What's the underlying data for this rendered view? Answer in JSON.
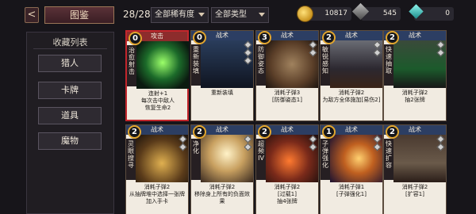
{
  "header": {
    "back_glyph": "<",
    "title": "图鉴",
    "count": "28/28",
    "rarity_filter": "全部稀有度",
    "type_filter": "全部类型"
  },
  "resources": {
    "gold": "10817",
    "ore": "545",
    "gem": "0"
  },
  "sidebar": {
    "title": "收藏列表",
    "items": [
      {
        "label": "猎人"
      },
      {
        "label": "卡牌"
      },
      {
        "label": "道具"
      },
      {
        "label": "魔物"
      }
    ]
  },
  "cards": [
    {
      "cost": "0",
      "type": "攻击",
      "name": "治愈射击",
      "desc": "连射+1\n每次击中敌人\n恢复生命2",
      "selected": true,
      "pips": 0,
      "art_icon": "green-heart-icon"
    },
    {
      "cost": "0",
      "type": "战术",
      "name": "重新装填",
      "desc": "重新装填",
      "selected": false,
      "pips": 3,
      "art_icon": "revolver-reload-icon"
    },
    {
      "cost": "3",
      "type": "战术",
      "name": "防御姿态",
      "desc": "消耗子弹3\n[防御姿态1]",
      "selected": false,
      "pips": 2,
      "art_icon": "shield-icon"
    },
    {
      "cost": "2",
      "type": "战术",
      "name": "敏锐感知",
      "desc": "消耗子弹2\n为敌方全体施加[易伤2]",
      "selected": false,
      "pips": 2,
      "art_icon": "awareness-icon"
    },
    {
      "cost": "2",
      "type": "战术",
      "name": "快速抽取",
      "desc": "消耗子弹2\n抽2张牌",
      "selected": false,
      "pips": 2,
      "art_icon": "cards-icon"
    },
    {
      "cost": "2",
      "type": "战术",
      "name": "灵眼搜寻",
      "desc": "消耗子弹2\n从抽牌堆中选择一张牌\n加入手卡",
      "selected": false,
      "pips": 2,
      "art_icon": "treasure-icon"
    },
    {
      "cost": "2",
      "type": "战术",
      "name": "净化",
      "desc": "消耗子弹2\n移除身上所有的负面效果",
      "selected": false,
      "pips": 2,
      "art_icon": "purify-icon"
    },
    {
      "cost": "2",
      "type": "战术",
      "name": "超频IV",
      "desc": "消耗子弹2\n[过载1]\n抽4张牌",
      "selected": false,
      "pips": 2,
      "art_icon": "overclock-icon"
    },
    {
      "cost": "1",
      "type": "战术",
      "name": "子弹强化",
      "desc": "消耗子弹1\n[子弹强化1]",
      "selected": false,
      "pips": 2,
      "art_icon": "bullet-icon"
    },
    {
      "cost": "2",
      "type": "战术",
      "name": "快速扩容",
      "desc": "消耗子弹2\n[扩容1]",
      "selected": false,
      "pips": 2,
      "art_icon": "revolver-icon"
    }
  ],
  "colors": {
    "attack_header": "#8d2c2c",
    "tactic_header": "#2c3e63",
    "selected_border": "#c2262c",
    "cost_ring": "#e1a52e"
  }
}
